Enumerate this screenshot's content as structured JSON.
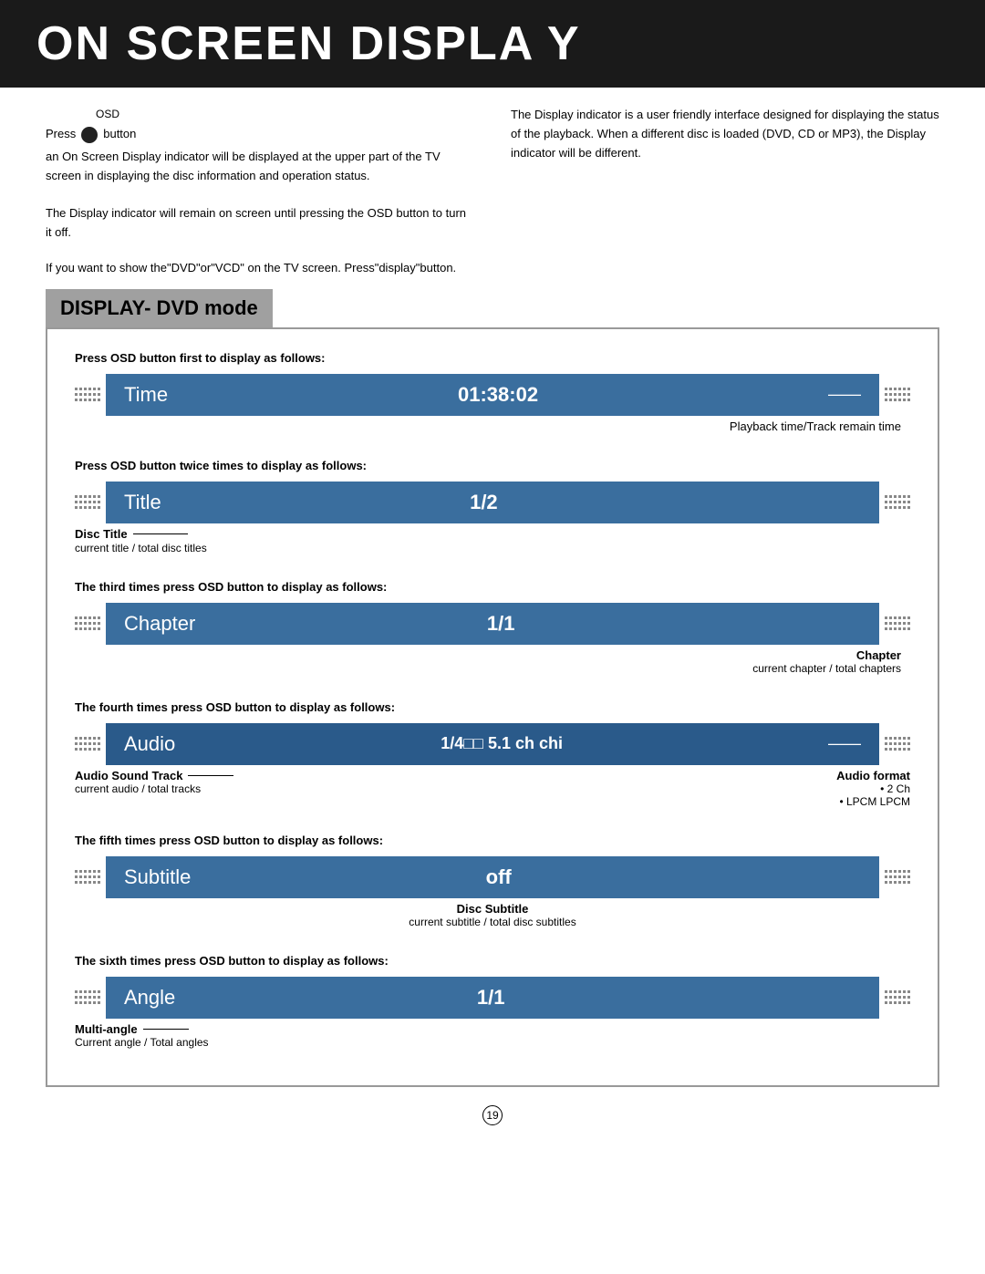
{
  "header": {
    "title": "ON SCREEN DISPLA Y"
  },
  "intro": {
    "osd_label": "OSD",
    "press_label": "Press",
    "button_label": "button",
    "left_text_1": "an On Screen Display indicator will be displayed at the upper part of the TV screen in displaying the disc information and operation status.",
    "left_text_2": "The Display indicator will remain on screen until pressing the OSD button to turn it off.",
    "right_text_1": "The Display indicator  is a user friendly interface designed for displaying  the status of  the playback. When a different disc is  loaded (DVD, CD or MP3), the Display indicator will be different.",
    "if_you_want": "If you want to show the\"DVD\"or\"VCD\" on the TV screen. Press\"display\"button."
  },
  "dvd_mode": {
    "title": "DISPLAY- DVD mode",
    "sections": [
      {
        "id": "time",
        "label": "Press OSD button first to display as follows:",
        "display_label": "Time",
        "display_value": "01:38:02",
        "has_arrow": true,
        "annotation_right": "Playback time/Track remain time"
      },
      {
        "id": "title",
        "label": "Press OSD button twice times to display as follows:",
        "display_label": "Title",
        "display_value": "1/2",
        "has_arrow": false,
        "annotation_left_main": "Disc Title",
        "annotation_left_sub": "current title / total disc titles"
      },
      {
        "id": "chapter",
        "label": "The third times press OSD button to display as follows:",
        "display_label": "Chapter",
        "display_value": "1/1",
        "has_arrow": false,
        "annotation_right_main": "Chapter",
        "annotation_right_sub": "current chapter / total chapters"
      },
      {
        "id": "audio",
        "label": "The fourth times press OSD button to display as follows:",
        "display_label": "Audio",
        "display_value": "1/4□□ 5.1 ch chi",
        "has_arrow": true,
        "annotation_left_main": "Audio Sound Track",
        "annotation_left_sub": "current audio / total tracks",
        "annotation_right_main": "Audio format",
        "annotation_right_sub1": "• 2 Ch",
        "annotation_right_sub2": "• LPCM  LPCM"
      },
      {
        "id": "subtitle",
        "label": "The fifth times press OSD button to display as follows:",
        "display_label": "Subtitle",
        "display_value": "off",
        "has_arrow": false,
        "annotation_center_main": "Disc Subtitle",
        "annotation_center_sub": "current subtitle / total disc subtitles"
      },
      {
        "id": "angle",
        "label": "The sixth times press OSD button to display as follows:",
        "display_label": "Angle",
        "display_value": "1/1",
        "has_arrow": false,
        "annotation_left_main": "Multi-angle",
        "annotation_left_sub": "Current angle / Total angles"
      }
    ]
  },
  "page_number": "19"
}
